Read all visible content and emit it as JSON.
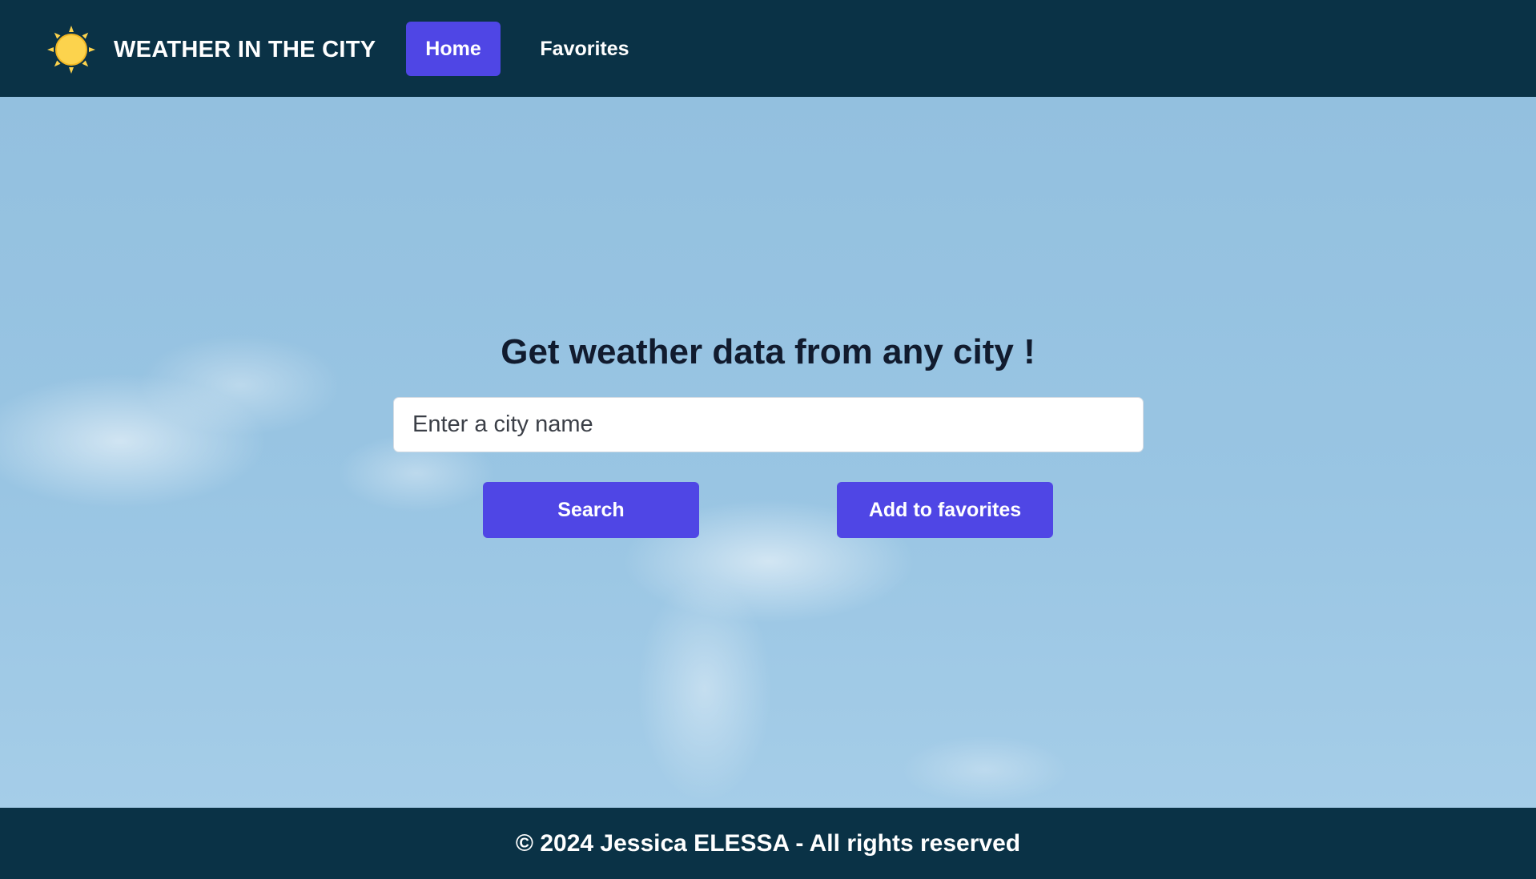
{
  "header": {
    "logo_icon": "sun-icon",
    "brand": "WEATHER IN THE CITY",
    "nav": {
      "home": "Home",
      "favorites": "Favorites"
    }
  },
  "main": {
    "title": "Get weather data from any city !",
    "search": {
      "placeholder": "Enter a city name",
      "value": ""
    },
    "buttons": {
      "search": "Search",
      "add_favorites": "Add to favorites"
    }
  },
  "footer": {
    "text": "© 2024 Jessica ELESSA - All rights reserved"
  },
  "colors": {
    "header_bg": "#0a3246",
    "accent": "#4f46e5",
    "sun": "#fcd34d",
    "sky": "#97c3e2",
    "title_text": "#111b2e"
  }
}
